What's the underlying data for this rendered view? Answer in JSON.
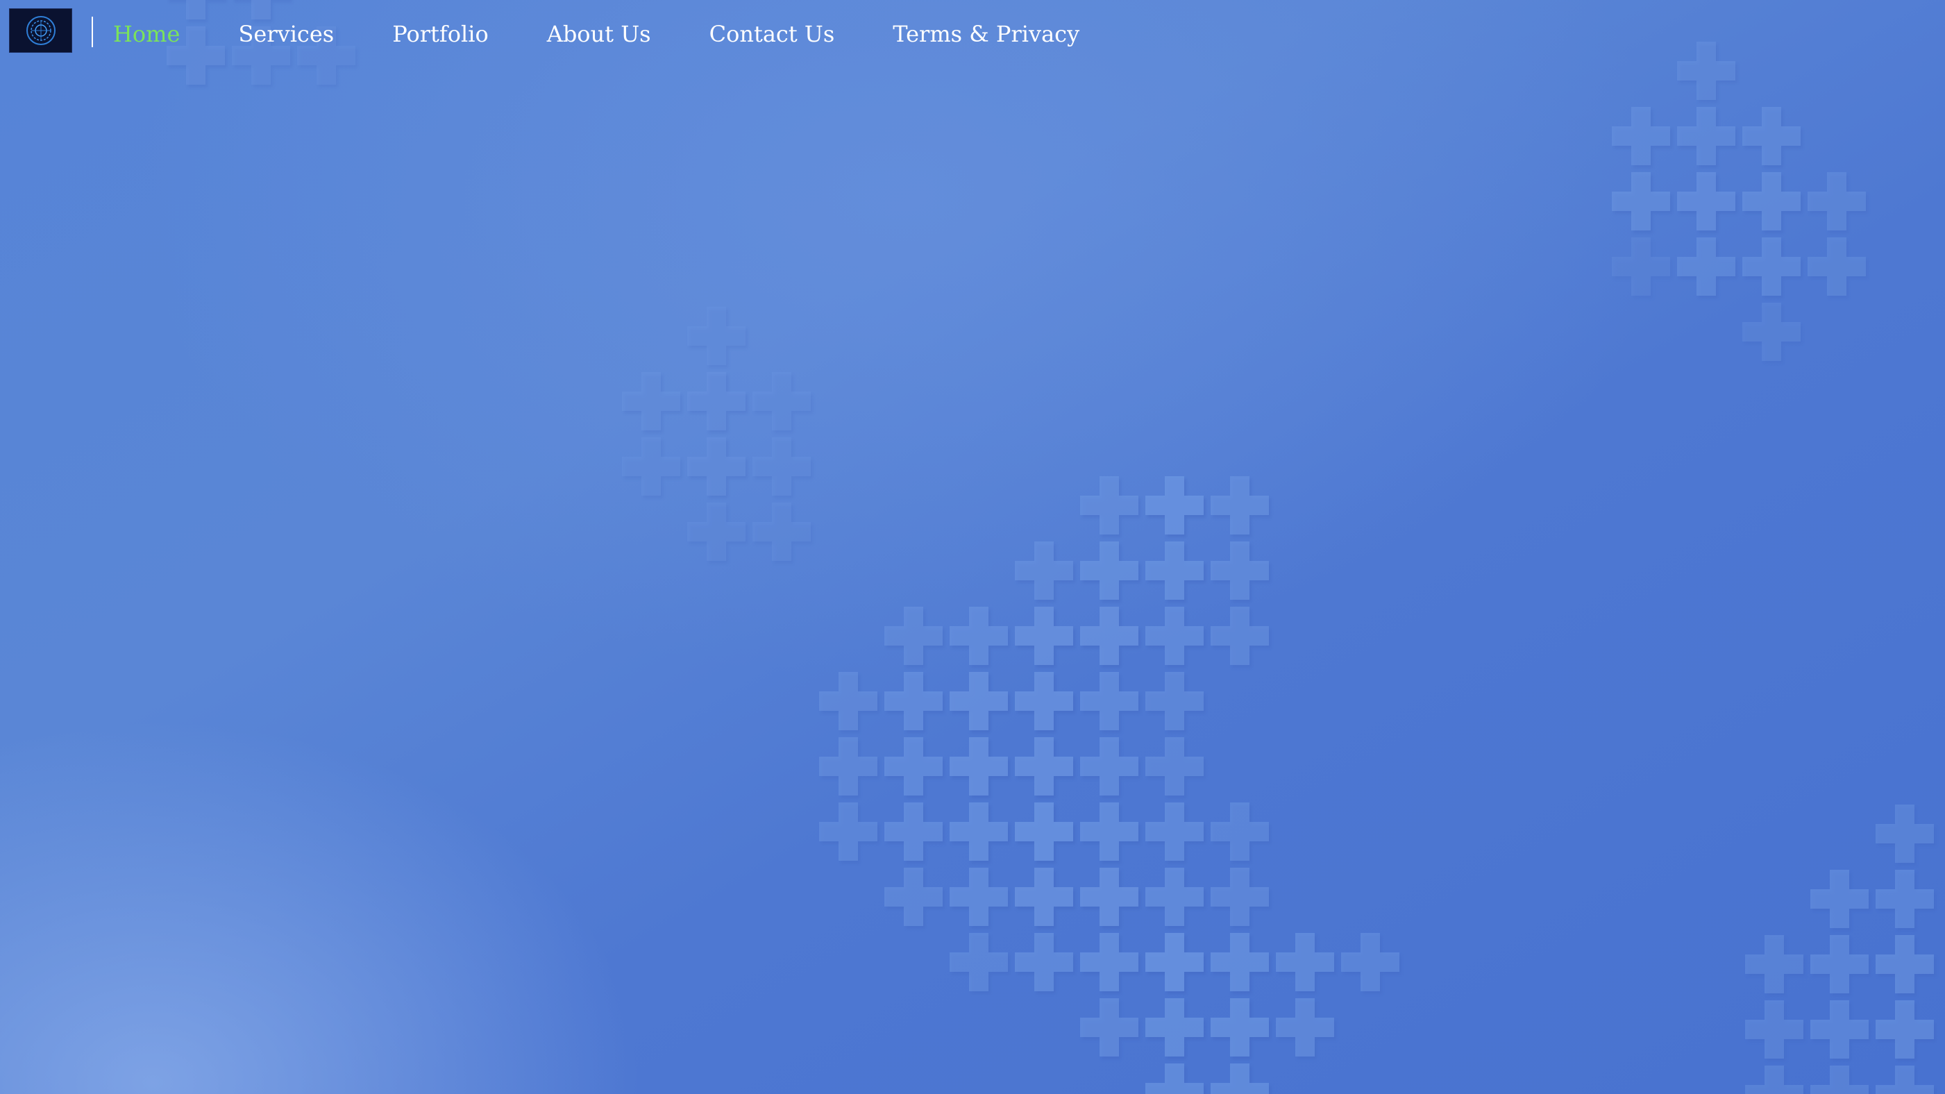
{
  "colors": {
    "background": "#5582d6",
    "nav_text": "#ffffff",
    "nav_active": "#7be35a",
    "logo_bg": "#0a1230",
    "logo_mark": "#2f7fd8",
    "plus_light": "#6a94e0",
    "plus_shadow": "#3c62bd"
  },
  "logo": {
    "icon": "circular-emblem-icon"
  },
  "nav": {
    "items": [
      {
        "label": "Home",
        "active": true
      },
      {
        "label": "Services",
        "active": false
      },
      {
        "label": "Portfolio",
        "active": false
      },
      {
        "label": "About Us",
        "active": false
      },
      {
        "label": "Contact Us",
        "active": false
      },
      {
        "label": "Terms & Privacy",
        "active": false
      }
    ]
  }
}
